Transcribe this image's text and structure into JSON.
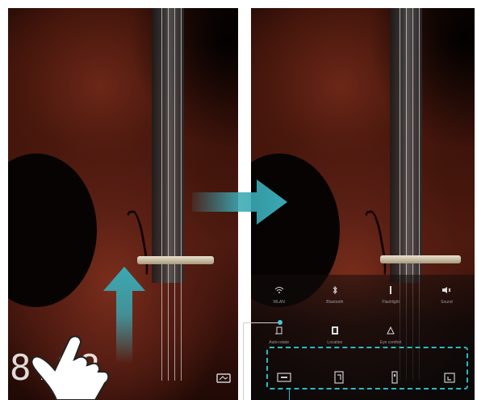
{
  "left_screen": {
    "clock_time": "8:08"
  },
  "right_screen": {
    "toggles": [
      {
        "icon": "wlan-icon",
        "label": "WLAN"
      },
      {
        "icon": "bluetooth-icon",
        "label": "Bluetooth"
      },
      {
        "icon": "flashlight-icon",
        "label": "Flashlight"
      },
      {
        "icon": "sound-icon",
        "label": "Sound"
      },
      {
        "icon": "auto-rotate-icon",
        "label": "Auto-rotate"
      },
      {
        "icon": "location-icon",
        "label": "Location"
      },
      {
        "icon": "eye-comfort-icon",
        "label": "Eye comfort"
      }
    ],
    "shortcuts": [
      {
        "icon": "recorder-icon"
      },
      {
        "icon": "calculator-icon"
      },
      {
        "icon": "flashlight-shortcut-icon"
      },
      {
        "icon": "camera-icon"
      }
    ]
  },
  "colors": {
    "accent": "#2bb8c8",
    "arrow": "#3aa9b4"
  }
}
